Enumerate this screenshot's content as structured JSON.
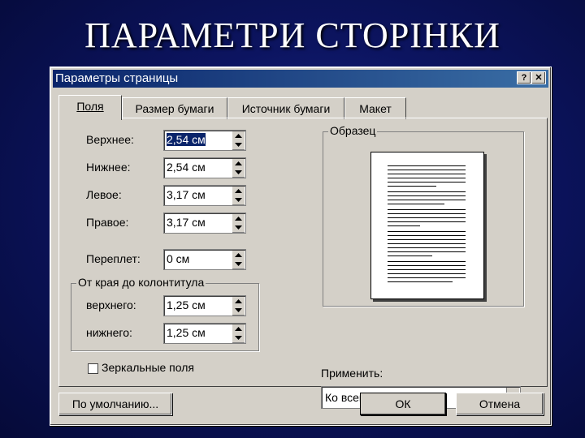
{
  "slide": {
    "title": "ПАРАМЕТРИ СТОРІНКИ"
  },
  "dialog": {
    "title": "Параметры страницы",
    "help_label": "?",
    "close_label": "✕"
  },
  "tabs": [
    {
      "label": "Поля"
    },
    {
      "label": "Размер бумаги"
    },
    {
      "label": "Источник бумаги"
    },
    {
      "label": "Макет"
    }
  ],
  "margins": {
    "top_label": "Верхнее:",
    "top_value": "2,54 см",
    "bottom_label": "Нижнее:",
    "bottom_value": "2,54 см",
    "left_label": "Левое:",
    "left_value": "3,17 см",
    "right_label": "Правое:",
    "right_value": "3,17 см",
    "gutter_label": "Переплет:",
    "gutter_value": "0 см"
  },
  "header_footer": {
    "group_title": "От края до колонтитула",
    "header_label": "верхнего:",
    "header_value": "1,25 см",
    "footer_label": "нижнего:",
    "footer_value": "1,25 см"
  },
  "preview": {
    "group_title": "Образец"
  },
  "apply": {
    "label": "Применить:",
    "value": "Ко всему документу"
  },
  "mirror_margins": {
    "label": "Зеркальные поля",
    "checked": false
  },
  "buttons": {
    "default_label": "По умолчанию...",
    "ok_label": "ОК",
    "cancel_label": "Отмена"
  }
}
